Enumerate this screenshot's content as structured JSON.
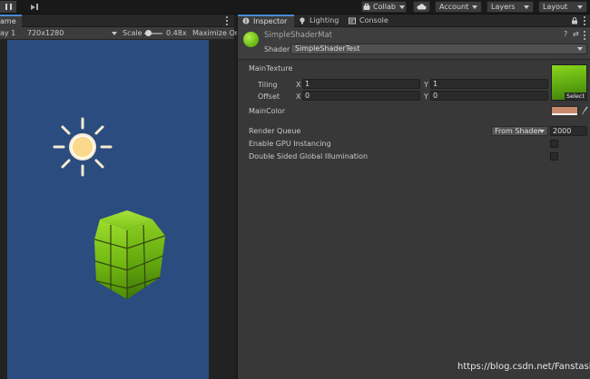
{
  "toolbar": {
    "collab_label": "Collab",
    "account_label": "Account",
    "layers_label": "Layers",
    "layout_label": "Layout"
  },
  "game": {
    "tab_label": "ame",
    "display_label": "ay 1",
    "resolution": "720x1280",
    "scale_label": "Scale",
    "scale_value": "0.48x",
    "maximize_label": "Maximize On"
  },
  "inspector": {
    "tabs": [
      {
        "label": "Inspector",
        "icon": "info-icon",
        "active": true
      },
      {
        "label": "Lighting",
        "icon": "bulb-icon",
        "active": false
      },
      {
        "label": "Console",
        "icon": "console-icon",
        "active": false
      }
    ],
    "material_name": "SimpleShaderMat",
    "shader_label": "Shader",
    "shader_value": "SimpleShaderTest",
    "main_texture": {
      "label": "MainTexture",
      "tiling_label": "Tiling",
      "offset_label": "Offset",
      "x_axis": "X",
      "y_axis": "Y",
      "tiling_x": "1",
      "tiling_y": "1",
      "offset_x": "0",
      "offset_y": "0",
      "select_label": "Select"
    },
    "main_color": {
      "label": "MainColor",
      "color": "#c88a6a"
    },
    "render_queue": {
      "label": "Render Queue",
      "mode": "From Shader",
      "value": "2000"
    },
    "gpu_instancing_label": "Enable GPU Instancing",
    "double_sided_gi_label": "Double Sided Global Illumination"
  },
  "watermark": "https://blog.csdn.net/Fanstasic",
  "colors": {
    "viewport": "#2b4c7e",
    "accent": "#4a8cd4",
    "cube_green": "#7ec21a",
    "panel": "#383838"
  }
}
